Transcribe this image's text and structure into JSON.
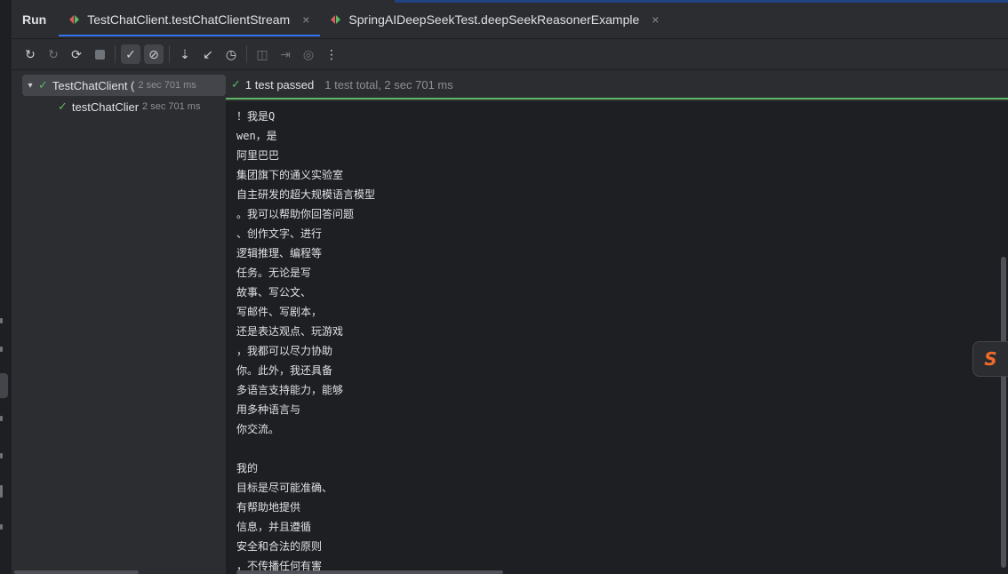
{
  "tabbar": {
    "run_label": "Run",
    "tabs": [
      {
        "label": "TestChatClient.testChatClientStream",
        "close": "×"
      },
      {
        "label": "SpringAIDeepSeekTest.deepSeekReasonerExample",
        "close": "×"
      }
    ]
  },
  "toolbar": {
    "icons": [
      "rerun-icon",
      "rerun-failed-icon",
      "rerun-auto-icon",
      "stop-icon",
      "show-passed-icon",
      "show-ignored-icon",
      "sort-alpha-icon",
      "sort-duration-icon",
      "history-icon",
      "screenshot-icon",
      "export-icon",
      "coverage-icon",
      "more-icon"
    ]
  },
  "tree": {
    "root": {
      "label": "TestChatClient (",
      "time": "2 sec 701 ms"
    },
    "child": {
      "label": "testChatClier",
      "time": "2 sec 701 ms"
    }
  },
  "status": {
    "passed": "1 test passed",
    "summary": "1 test total, 2 sec 701 ms"
  },
  "console": {
    "lines": [
      "！我是Q",
      "wen，是",
      "阿里巴巴",
      "集团旗下的通义实验室",
      "自主研发的超大规模语言模型",
      "。我可以帮助你回答问题",
      "、创作文字、进行",
      "逻辑推理、编程等",
      "任务。无论是写",
      "故事、写公文、",
      "写邮件、写剧本，",
      "还是表达观点、玩游戏",
      "，我都可以尽力协助",
      "你。此外，我还具备",
      "多语言支持能力，能够",
      "用多种语言与",
      "你交流。",
      "",
      "我的",
      "目标是尽可能准确、",
      "有帮助地提供",
      "信息，并且遵循",
      "安全和合法的原则",
      "，不传播任何有害"
    ]
  },
  "plugin": {
    "glyph": "S"
  },
  "colors": {
    "pass": "#5fb865",
    "accent": "#3574f0",
    "plugin": "#f06a2a"
  }
}
